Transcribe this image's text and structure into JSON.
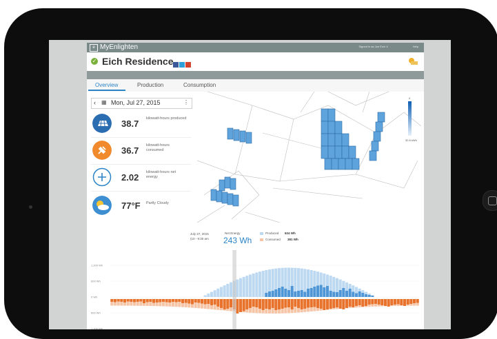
{
  "app": {
    "brand": "MyEnlighten",
    "logo_glyph": "e",
    "signed_in": "Signed in as Joe Eich ∨",
    "help": "Help"
  },
  "site": {
    "title": "Eich Residence"
  },
  "tabs": [
    {
      "label": "Overview",
      "active": true
    },
    {
      "label": "Production",
      "active": false
    },
    {
      "label": "Consumption",
      "active": false
    }
  ],
  "date_nav": {
    "prev": "‹",
    "calendar_icon": "calendar-icon",
    "date": "Mon, Jul 27, 2015",
    "next": "⋮"
  },
  "stats": [
    {
      "icon": "solar-panel-icon",
      "color": "#2b6db1",
      "value": "38.7",
      "unit": "kilowatt-hours produced"
    },
    {
      "icon": "plug-icon",
      "color": "#f08a2c",
      "value": "36.7",
      "unit": "kilowatt-hours consumed"
    },
    {
      "icon": "plus-icon",
      "color": "#2b84c6",
      "value": "2.02",
      "unit": "kilowatt-hours net energy"
    },
    {
      "icon": "partly-cloudy-icon",
      "color": "#9bc6e8",
      "value": "77°F",
      "unit": "Partly Cloudy"
    }
  ],
  "map": {
    "scale_top": "0",
    "scale_bottom": "32.8 kWh",
    "scale_color_top": "#0f5fb3",
    "scale_color_bottom": "#e7f1fb"
  },
  "summary": {
    "date": "July 27, 2015",
    "time": "(10 - 9:30 am",
    "net_label": "Net Energy",
    "net_value": "243 Wh",
    "produced_label": "Produced",
    "produced_value": "624 Wh",
    "consumed_label": "Consumed",
    "consumed_value": "381 Wh"
  },
  "colors": {
    "produced": "#4f96d6",
    "produced_light": "#bcd9f1",
    "consumed": "#e8732c",
    "consumed_light": "#f6c4a6",
    "accent": "#2b84c6"
  },
  "chart_data": {
    "type": "bar",
    "y_ticks": [
      "1,200 Wh",
      "600 Wh",
      "0 Wh",
      "600 Wh",
      "1,200 Wh"
    ],
    "ylim": [
      -1200,
      1200
    ],
    "bars": 96,
    "series": [
      {
        "name": "Produced",
        "values": [
          0,
          0,
          0,
          0,
          0,
          0,
          0,
          0,
          0,
          0,
          0,
          0,
          0,
          0,
          0,
          0,
          0,
          0,
          0,
          0,
          0,
          0,
          0,
          0,
          0,
          0,
          0,
          0,
          0,
          0,
          0,
          0,
          0,
          0,
          0,
          0,
          0,
          0,
          0,
          0,
          0,
          0,
          0,
          0,
          0,
          0,
          0,
          0,
          120,
          160,
          180,
          220,
          260,
          300,
          240,
          200,
          320,
          160,
          180,
          200,
          150,
          240,
          260,
          300,
          330,
          350,
          280,
          320,
          180,
          150,
          140,
          200,
          260,
          180,
          240,
          150,
          110,
          160,
          120,
          80,
          60,
          40,
          0,
          0,
          0,
          0,
          0,
          0,
          0,
          0,
          0,
          0,
          0,
          0,
          0,
          0
        ]
      },
      {
        "name": "Consumed",
        "values": [
          -80,
          -90,
          -70,
          -80,
          -100,
          -70,
          -80,
          -90,
          -80,
          -70,
          -120,
          -90,
          -80,
          -110,
          -100,
          -90,
          -80,
          -90,
          -100,
          -80,
          -90,
          -80,
          -120,
          -110,
          -130,
          -150,
          -100,
          -110,
          -130,
          -150,
          -140,
          -180,
          -160,
          -220,
          -260,
          -300,
          -280,
          -240,
          -300,
          -420,
          -380,
          -350,
          -300,
          -260,
          -220,
          -240,
          -280,
          -320,
          -280,
          -300,
          -260,
          -320,
          -300,
          -280,
          -250,
          -240,
          -300,
          -220,
          -260,
          -300,
          -280,
          -250,
          -240,
          -230,
          -260,
          -280,
          -320,
          -300,
          -280,
          -260,
          -240,
          -280,
          -300,
          -260,
          -220,
          -240,
          -200,
          -180,
          -220,
          -200,
          -160,
          -150,
          -140,
          -160,
          -180,
          -200,
          -220,
          -180,
          -160,
          -150,
          -180,
          -200,
          -160,
          -140,
          -120,
          -110
        ]
      }
    ],
    "area_produced_peak": 850,
    "area_consumed_peak": -420
  }
}
